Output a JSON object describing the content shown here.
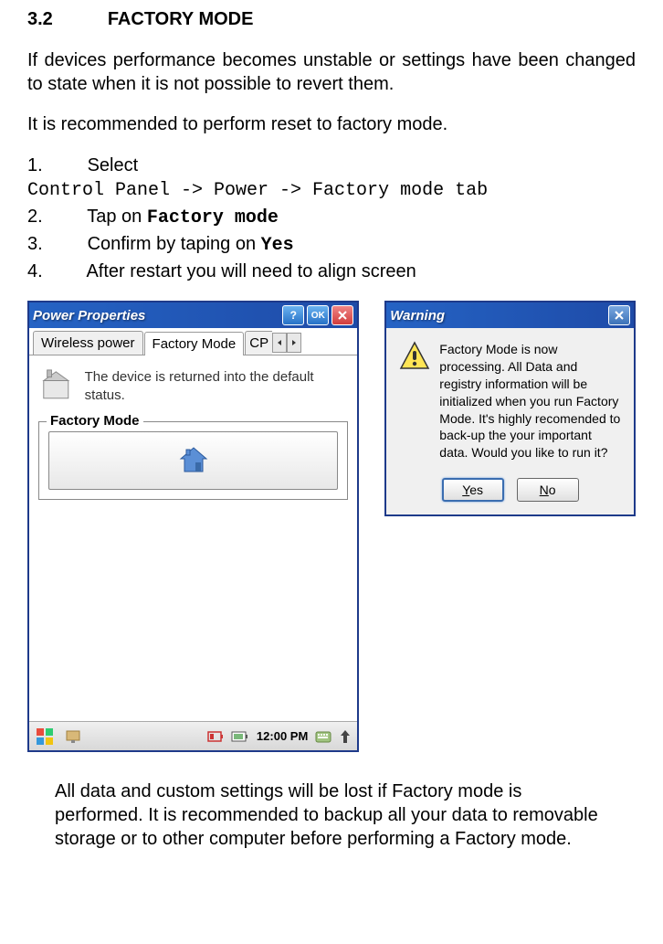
{
  "section": {
    "number": "3.2",
    "title": "FACTORY MODE"
  },
  "paragraphs": {
    "p1": "If devices performance becomes unstable or settings have been changed to state when it is not possible to revert them.",
    "p2": "It is recommended to perform reset to factory mode."
  },
  "steps": {
    "s1_num": "1.",
    "s1_text": "Select",
    "s1_path": "Control Panel -> Power -> Factory mode tab",
    "s2_num": "2.",
    "s2_prefix": "Tap on ",
    "s2_bold": "Factory mode",
    "s3_num": "3.",
    "s3_prefix": "Confirm by taping on ",
    "s3_bold": "Yes",
    "s4_num": "4.",
    "s4_text": "After restart you will need to align screen"
  },
  "window1": {
    "title": "Power Properties",
    "help": "?",
    "ok": "OK",
    "tabs": {
      "wireless": "Wireless power",
      "factory": "Factory Mode",
      "cp": "CP"
    },
    "info_text": "The device is returned into the default status.",
    "groupbox_label": "Factory Mode",
    "time": "12:00 PM"
  },
  "window2": {
    "title": "Warning",
    "message": "Factory Mode is now processing. All Data and registry information will be initialized when you run Factory Mode. It's highly recomended to back-up the your important data. Would you like to run it?",
    "yes": "Yes",
    "no": "No"
  },
  "footer": "All data and custom settings will be lost if Factory mode is performed. It is recommended to backup all your data to removable storage or to other computer before performing a Factory mode."
}
